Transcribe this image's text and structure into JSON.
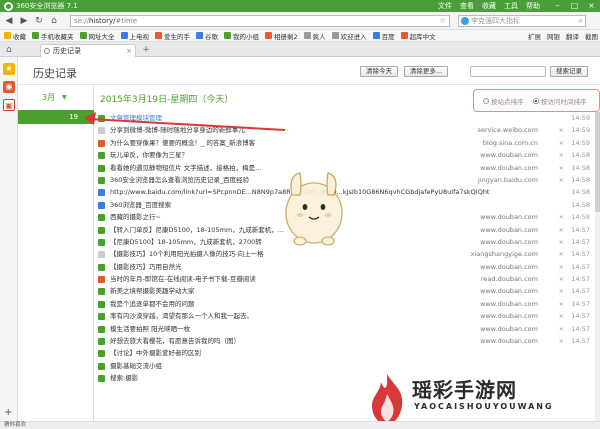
{
  "window": {
    "title": "360安全浏览器 7.1",
    "menus": [
      "文件",
      "查看",
      "收藏",
      "工具",
      "帮助"
    ]
  },
  "address": {
    "url_prefix": "se://",
    "url_path": "history/",
    "url_hash": "#time",
    "search_placeholder": "李克强四大指标"
  },
  "bookmarks": [
    {
      "label": "收藏",
      "color": "#f4b400"
    },
    {
      "label": "手机收藏夹",
      "color": "#4aa02c"
    },
    {
      "label": "网址大全",
      "color": "#4aa02c"
    },
    {
      "label": "上电视",
      "color": "#3b7de0"
    },
    {
      "label": "爱生的手",
      "color": "#e65a2e"
    },
    {
      "label": "谷歌",
      "color": "#3b7de0"
    },
    {
      "label": "我的小组",
      "color": "#4aa02c"
    },
    {
      "label": "相册剩2",
      "color": "#e65a2e"
    },
    {
      "label": "疯人",
      "color": "#999999"
    },
    {
      "label": "欢迎进入",
      "color": "#999999"
    },
    {
      "label": "百度",
      "color": "#3b7de0"
    },
    {
      "label": "超库中文",
      "color": "#e65a2e"
    }
  ],
  "bm_tools": [
    "扩展",
    "网银",
    "翻译",
    "截图"
  ],
  "tab": {
    "label": "历史记录"
  },
  "page": {
    "title": "历史记录",
    "clear_today": "清除今天",
    "clear_more": "清除更多...",
    "search_history": "搜索记录",
    "search_placeholder": "",
    "month": "3月",
    "day": "19",
    "date_title": "2015年3月19日-星期四（今天）",
    "sort_by_site": "按站点排序",
    "sort_by_time": "按访问时间排序"
  },
  "rows": [
    {
      "title": "文章管理模块管理",
      "domain": "",
      "x": "",
      "time": "14:59",
      "color": "#4aa02c"
    },
    {
      "title": "分享到微博-微博-随时随地分享身边的新鲜事儿",
      "domain": "service.weibo.com",
      "x": "×",
      "time": "14:59",
      "color": "#cccccc"
    },
    {
      "title": "为什么要穿像果？傻要的概念！_ 的答案_新浪博客",
      "domain": "blog.sina.com.cn",
      "x": "×",
      "time": "14:59",
      "color": "#e65a2e"
    },
    {
      "title": "玩儿单反，你要像为三星？",
      "domain": "www.douban.com",
      "x": "×",
      "time": "14:58",
      "color": "#4aa02c"
    },
    {
      "title": "看看她的遇见静物短信片 文字描述，接格拍，梅是...",
      "domain": "www.douban.com",
      "x": "×",
      "time": "14:58",
      "color": "#4aa02c"
    },
    {
      "title": "360安全浏览器怎么查看浏览历史记录_百度经验",
      "domain": "jingyan.baidu.com",
      "x": "×",
      "time": "14:58",
      "color": "#4aa02c"
    },
    {
      "title": "http://www.baidu.com/link?url=SPcpnnDE...N8N9p7a8R9u2ioW...9ko0...kJsIb10G86N6qvhCGbdjafePyU8ulfa7skQIQhtuscA...",
      "domain": "",
      "x": "",
      "time": "14:58",
      "color": "#3b7de0"
    },
    {
      "title": "360浏览器_百度搜索",
      "domain": "",
      "x": "",
      "time": "14:58",
      "color": "#3b7de0"
    },
    {
      "title": "西藏的摄影之行~",
      "domain": "www.douban.com",
      "x": "×",
      "time": "14:58",
      "color": "#4aa02c"
    },
    {
      "title": "【转入门单反】尼康D5100，18-105mm，九成新套机，...",
      "domain": "www.douban.com",
      "x": "×",
      "time": "14:57",
      "color": "#4aa02c"
    },
    {
      "title": "【尼康D5100】18-105mm，九成新套机，2700转",
      "domain": "www.douban.com",
      "x": "×",
      "time": "14:57",
      "color": "#4aa02c"
    },
    {
      "title": "【摄影技巧】10个利用阳光拍摄人像的技巧-向上一格",
      "domain": "xiangshangyige.com",
      "x": "×",
      "time": "14:57",
      "color": "#cccccc"
    },
    {
      "title": "【摄影技巧】巧用自然光",
      "domain": "www.douban.com",
      "x": "×",
      "time": "14:57",
      "color": "#4aa02c"
    },
    {
      "title": "当时的年月-即馆在-在线阅读-电子书下载-豆瓣阅读",
      "domain": "read.douban.com",
      "x": "×",
      "time": "14:57",
      "color": "#e65a2e"
    },
    {
      "title": "新美之境帮摄影美趣学动大家",
      "domain": "www.douban.com",
      "x": "×",
      "time": "14:57",
      "color": "#4aa02c"
    },
    {
      "title": "我是个追逐单都不会用的问题",
      "domain": "www.douban.com",
      "x": "×",
      "time": "14:57",
      "color": "#4aa02c"
    },
    {
      "title": "率有内沙漠穿越，渴望有那么一个人和我一起去。",
      "domain": "www.douban.com",
      "x": "×",
      "time": "14:57",
      "color": "#4aa02c"
    },
    {
      "title": "模生活要拍照 阳光映晒一枚",
      "domain": "www.douban.com",
      "x": "×",
      "time": "14:57",
      "color": "#4aa02c"
    },
    {
      "title": "好想去旅大看樱花，有愿意告诉我的吗（图）",
      "domain": "www.douban.com",
      "x": "×",
      "time": "14:57",
      "color": "#4aa02c"
    },
    {
      "title": "【讨论】中外摄影爱好者的区别",
      "domain": "",
      "x": "",
      "time": "",
      "color": "#4aa02c"
    },
    {
      "title": "摄影基础交流小组",
      "domain": "",
      "x": "",
      "time": "",
      "color": "#4aa02c"
    },
    {
      "title": "搜索:摄影",
      "domain": "",
      "x": "",
      "time": "",
      "color": "#4aa02c"
    }
  ],
  "status": {
    "text": "猜你喜欢"
  },
  "watermark": {
    "text": "瑶彩手游网",
    "pinyin": "YAOCAISHOUYOUWANG"
  },
  "colors": {
    "accent": "#4aa02c",
    "titlebar": "#4a9e3a",
    "annotation": "#d9383a"
  }
}
